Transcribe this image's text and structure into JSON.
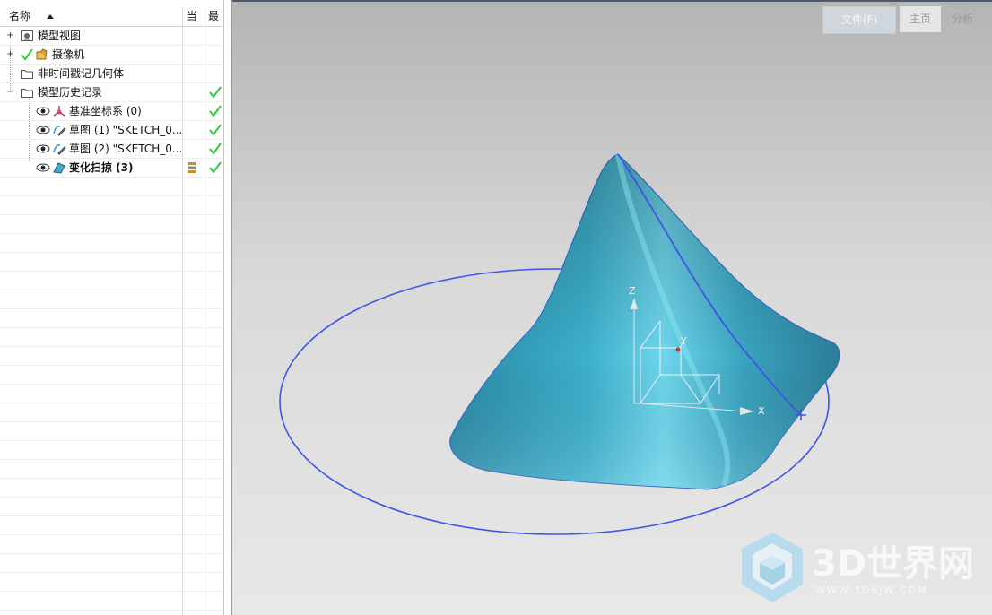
{
  "navigator": {
    "columns": {
      "name": "名称",
      "current": "当",
      "latest": "最"
    },
    "items": [
      {
        "label": "模型视图",
        "icon": "model-view-icon",
        "expander": "+",
        "check": false
      },
      {
        "label": "摄像机",
        "icon": "camera-icon",
        "expander": "+",
        "check": false,
        "prefix_check": true
      },
      {
        "label": "非时间戳记几何体",
        "icon": "folder-icon",
        "expander": "",
        "check": false
      },
      {
        "label": "模型历史记录",
        "icon": "folder-icon",
        "expander": "−",
        "check": true
      },
      {
        "label": "基准坐标系 (0)",
        "icon": "datum-csys-icon",
        "check": true
      },
      {
        "label": "草图 (1) \"SKETCH_0...",
        "icon": "sketch-icon",
        "check": true
      },
      {
        "label": "草图 (2) \"SKETCH_0...",
        "icon": "sketch-icon",
        "check": true
      },
      {
        "label": "变化扫掠 (3)",
        "icon": "variational-sweep-icon",
        "check": true,
        "bold": true,
        "current_marker": true
      }
    ]
  },
  "ribbon": {
    "file_tab": "文件(F)",
    "home_tab": "主页",
    "analysis_tab": "分析"
  },
  "viewport": {
    "axes": {
      "z": "Z",
      "y": "Y",
      "x": "X"
    },
    "watermark": {
      "title": "3D世界网",
      "url": "WWW.3DSJW.COM"
    }
  },
  "colors": {
    "surface": "#3fa8c0",
    "curve": "#4058e0",
    "check": "#2ecc40",
    "background_top": "#b4b4b4",
    "background_bottom": "#e8e8e8"
  }
}
